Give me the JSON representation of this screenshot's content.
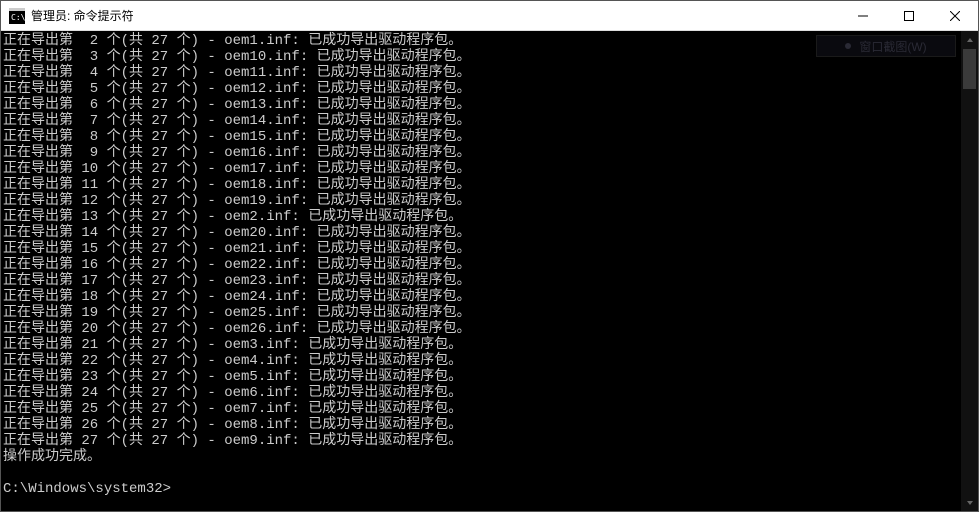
{
  "window": {
    "title": "管理员: 命令提示符"
  },
  "ghost_button": {
    "label": "窗口截图(W)"
  },
  "console": {
    "total": 27,
    "prefix": "正在导出第",
    "mid1": "个(共",
    "mid2": "个) -",
    "success": "已成功导出驱动程序包。",
    "done": "操作成功完成。",
    "prompt": "C:\\Windows\\system32>",
    "lines": [
      {
        "idx": 2,
        "file": "oem1.inf"
      },
      {
        "idx": 3,
        "file": "oem10.inf"
      },
      {
        "idx": 4,
        "file": "oem11.inf"
      },
      {
        "idx": 5,
        "file": "oem12.inf"
      },
      {
        "idx": 6,
        "file": "oem13.inf"
      },
      {
        "idx": 7,
        "file": "oem14.inf"
      },
      {
        "idx": 8,
        "file": "oem15.inf"
      },
      {
        "idx": 9,
        "file": "oem16.inf"
      },
      {
        "idx": 10,
        "file": "oem17.inf"
      },
      {
        "idx": 11,
        "file": "oem18.inf"
      },
      {
        "idx": 12,
        "file": "oem19.inf"
      },
      {
        "idx": 13,
        "file": "oem2.inf"
      },
      {
        "idx": 14,
        "file": "oem20.inf"
      },
      {
        "idx": 15,
        "file": "oem21.inf"
      },
      {
        "idx": 16,
        "file": "oem22.inf"
      },
      {
        "idx": 17,
        "file": "oem23.inf"
      },
      {
        "idx": 18,
        "file": "oem24.inf"
      },
      {
        "idx": 19,
        "file": "oem25.inf"
      },
      {
        "idx": 20,
        "file": "oem26.inf"
      },
      {
        "idx": 21,
        "file": "oem3.inf"
      },
      {
        "idx": 22,
        "file": "oem4.inf"
      },
      {
        "idx": 23,
        "file": "oem5.inf"
      },
      {
        "idx": 24,
        "file": "oem6.inf"
      },
      {
        "idx": 25,
        "file": "oem7.inf"
      },
      {
        "idx": 26,
        "file": "oem8.inf"
      },
      {
        "idx": 27,
        "file": "oem9.inf"
      }
    ]
  }
}
